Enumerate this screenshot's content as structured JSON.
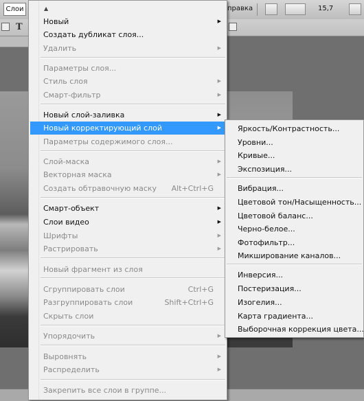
{
  "menubar": {
    "active_menu": "Слои",
    "help_menu": "правка",
    "zoom_readout": "15,7"
  },
  "main_menu": {
    "top_arrow": "▲",
    "items": [
      {
        "label": "Новый",
        "submenu": true,
        "disabled": false
      },
      {
        "label": "Создать дубликат слоя...",
        "disabled": false
      },
      {
        "label": "Удалить",
        "submenu": true,
        "disabled": true
      },
      {
        "label": "Параметры слоя...",
        "disabled": true
      },
      {
        "label": "Стиль слоя",
        "submenu": true,
        "disabled": true
      },
      {
        "label": "Смарт-фильтр",
        "submenu": true,
        "disabled": true
      },
      {
        "label": "Новый слой-заливка",
        "submenu": true,
        "disabled": false
      },
      {
        "label": "Новый корректирующий слой",
        "submenu": true,
        "disabled": false,
        "highlighted": true
      },
      {
        "label": "Параметры содержимого слоя...",
        "disabled": true
      },
      {
        "label": "Слой-маска",
        "submenu": true,
        "disabled": true
      },
      {
        "label": "Векторная маска",
        "submenu": true,
        "disabled": true
      },
      {
        "label": "Создать обтравочную маску",
        "shortcut": "Alt+Ctrl+G",
        "disabled": true
      },
      {
        "label": "Смарт-объект",
        "submenu": true,
        "disabled": false
      },
      {
        "label": "Слои видео",
        "submenu": true,
        "disabled": false
      },
      {
        "label": "Шрифты",
        "submenu": true,
        "disabled": true
      },
      {
        "label": "Растрировать",
        "submenu": true,
        "disabled": true
      },
      {
        "label": "Новый фрагмент из слоя",
        "disabled": true
      },
      {
        "label": "Сгруппировать слои",
        "shortcut": "Ctrl+G",
        "disabled": true
      },
      {
        "label": "Разгруппировать слои",
        "shortcut": "Shift+Ctrl+G",
        "disabled": true
      },
      {
        "label": "Скрыть слои",
        "disabled": true
      },
      {
        "label": "Упорядочить",
        "submenu": true,
        "disabled": true
      },
      {
        "label": "Выровнять",
        "submenu": true,
        "disabled": true
      },
      {
        "label": "Распределить",
        "submenu": true,
        "disabled": true
      },
      {
        "label": "Закрепить все слои в группе...",
        "disabled": true
      }
    ]
  },
  "sub_menu": {
    "items": [
      {
        "label": "Яркость/Контрастность..."
      },
      {
        "label": "Уровни..."
      },
      {
        "label": "Кривые..."
      },
      {
        "label": "Экспозиция..."
      },
      {
        "label": "Вибрация..."
      },
      {
        "label": "Цветовой тон/Насыщенность..."
      },
      {
        "label": "Цветовой баланс..."
      },
      {
        "label": "Черно-белое..."
      },
      {
        "label": "Фотофильтр..."
      },
      {
        "label": "Микширование каналов..."
      },
      {
        "label": "Инверсия..."
      },
      {
        "label": "Постеризация..."
      },
      {
        "label": "Изогелия..."
      },
      {
        "label": "Карта градиента..."
      },
      {
        "label": "Выборочная коррекция цвета..."
      }
    ]
  },
  "submenu_arrow_glyph": "▶",
  "colors": {
    "highlight": "#3399ff",
    "menu_bg": "#f0f0f0",
    "disabled_text": "#8a8a8a"
  }
}
